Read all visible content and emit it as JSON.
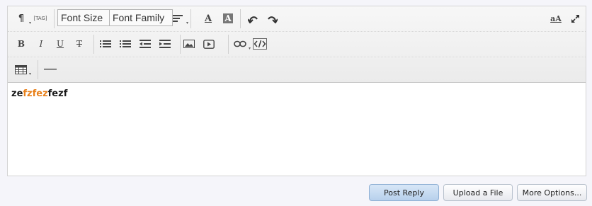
{
  "toolbar": {
    "paragraph_icon": "¶",
    "tag_icon": "[TAG]",
    "font_size_label": "Font Size",
    "font_family_label": "Font Family",
    "text_color_icon": "A",
    "bg_color_icon": "A",
    "bold": "B",
    "italic": "I",
    "underline": "U",
    "strike": "T",
    "translate_icon": "aA"
  },
  "content": {
    "segments": [
      {
        "text": "ze",
        "color": "#1a1a1a"
      },
      {
        "text": "fzfez",
        "color": "#e8801a"
      },
      {
        "text": "fezf",
        "color": "#1a1a1a"
      }
    ]
  },
  "buttons": {
    "post_reply": "Post Reply",
    "upload_file": "Upload a File",
    "more_options": "More Options..."
  },
  "colors": {
    "accent_orange": "#e8801a",
    "primary_button": "#c7dcf1"
  }
}
